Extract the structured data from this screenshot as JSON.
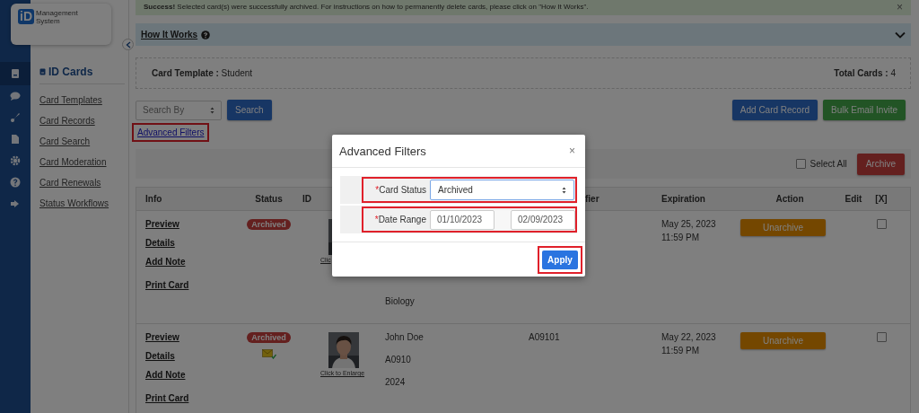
{
  "logo": {
    "mark": "iD",
    "lines": [
      "Management",
      "System"
    ]
  },
  "rail": [
    {
      "selected": true
    },
    {
      "selected": false
    },
    {
      "selected": false
    },
    {
      "selected": false
    },
    {
      "selected": false
    },
    {
      "selected": false
    },
    {
      "selected": false
    }
  ],
  "nav": {
    "heading": "ID Cards",
    "items": [
      "Card Templates",
      "Card Records",
      "Card Search",
      "Card Moderation",
      "Card Renewals",
      "Status Workflows"
    ]
  },
  "alert": {
    "text": "**Success!** Selected card(s) were successfully archived. For instructions on how to permanently delete cards, please click on \"How It Works\".",
    "close": "×"
  },
  "how_it_works": {
    "label": "How It Works",
    "expanded": false
  },
  "summary": {
    "template_label": "Card Template :",
    "template_value": "Student",
    "total_label": "Total Cards :",
    "total_value": "4"
  },
  "search": {
    "placeholder": "Search By",
    "button": "Search"
  },
  "advanced_filters_link": {
    "label": "Advanced Filters",
    "highlighted": true
  },
  "buttons": [
    {
      "label": "Add Card Record",
      "kind": "primary"
    },
    {
      "label": "Bulk Email Invite",
      "kind": "success"
    }
  ],
  "select_all": {
    "label": "Select All",
    "checked": false
  },
  "archive_button": "Archive",
  "table": {
    "columns": [
      "Info",
      "Status",
      "ID",
      "fier",
      "Expiration",
      "Action",
      "Edit",
      "[X]"
    ],
    "rows": [
      {
        "links": [
          "Preview",
          "Details",
          "Add Note",
          "Print Card"
        ],
        "status": "Archived",
        "email_sent": false,
        "enlarge": "Clic",
        "details": [
          "Biology"
        ],
        "identifier": "",
        "expiration": [
          "May 25, 2023",
          "11:59 PM"
        ],
        "action": "Unarchive",
        "checked": false
      },
      {
        "links": [
          "Preview",
          "Details",
          "Add Note",
          "Print Card"
        ],
        "status": "Archived",
        "email_sent": true,
        "enlarge": "Click to Enlarge",
        "details": [
          "John Doe",
          "A0910",
          "2024"
        ],
        "identifier": "A09101",
        "expiration": [
          "May 22, 2023",
          "11:59 PM"
        ],
        "action": "Unarchive",
        "checked": false
      }
    ]
  },
  "modal": {
    "title": "Advanced Filters",
    "close": "×",
    "fields": [
      {
        "kind": "select",
        "label": "Card Status",
        "required_mark": "*",
        "highlighted": true,
        "value": "Archived"
      },
      {
        "kind": "date_range",
        "label": "Date Range",
        "required_mark": "*",
        "highlighted": true,
        "values": [
          "01/10/2023",
          "02/09/2023"
        ]
      }
    ],
    "apply": {
      "label": "Apply",
      "highlighted": true
    }
  }
}
